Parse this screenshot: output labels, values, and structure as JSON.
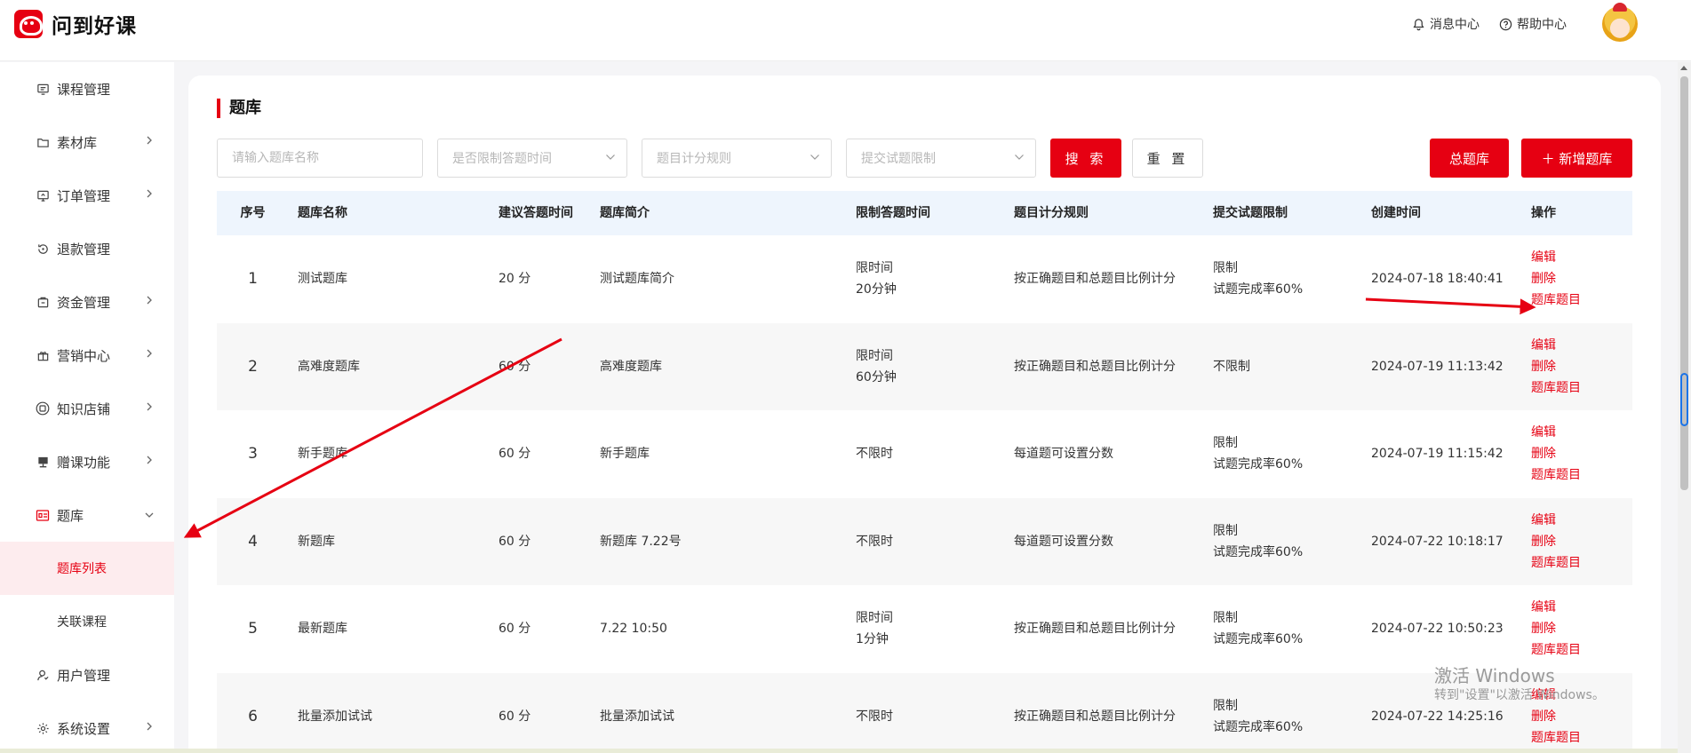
{
  "app": {
    "name": "问到好课"
  },
  "header": {
    "messages": "消息中心",
    "help": "帮助中心"
  },
  "sidebar": {
    "items": [
      {
        "label": "课程管理",
        "icon": "course-icon"
      },
      {
        "label": "素材库",
        "icon": "folder-icon"
      },
      {
        "label": "订单管理",
        "icon": "order-icon"
      },
      {
        "label": "退款管理",
        "icon": "refund-icon"
      },
      {
        "label": "资金管理",
        "icon": "wallet-icon"
      },
      {
        "label": "营销中心",
        "icon": "gift-icon"
      },
      {
        "label": "知识店铺",
        "icon": "shop-icon"
      },
      {
        "label": "赠课功能",
        "icon": "gift-course-icon"
      },
      {
        "label": "题库",
        "icon": "quiz-icon"
      },
      {
        "label": "用户管理",
        "icon": "user-icon"
      },
      {
        "label": "系统设置",
        "icon": "gear-icon"
      }
    ],
    "sub": [
      {
        "label": "题库列表",
        "active": true
      },
      {
        "label": "关联课程",
        "active": false
      }
    ]
  },
  "page": {
    "title": "题库"
  },
  "filters": {
    "name_placeholder": "请输入题库名称",
    "time_limit": "是否限制答题时间",
    "scoring": "题目计分规则",
    "submit_limit": "提交试题限制",
    "search": "搜 索",
    "reset": "重 置",
    "all_banks": "总题库",
    "add_bank": "＋ 新增题库"
  },
  "table": {
    "headers": [
      "序号",
      "题库名称",
      "建议答题时间",
      "题库简介",
      "限制答题时间",
      "题目计分规则",
      "提交试题限制",
      "创建时间",
      "操作"
    ],
    "actions": [
      "编辑",
      "删除",
      "题库题目"
    ],
    "rows": [
      {
        "no": "1",
        "name": "测试题库",
        "suggest": "20 分",
        "intro": "测试题库简介",
        "limit1": "限时间",
        "limit2": "20分钟",
        "rule": "按正确题目和总题目比例计分",
        "submit1": "限制",
        "submit2": "试题完成率60%",
        "created": "2024-07-18 18:40:41"
      },
      {
        "no": "2",
        "name": "高难度题库",
        "suggest": "60 分",
        "intro": "高难度题库",
        "limit1": "限时间",
        "limit2": "60分钟",
        "rule": "按正确题目和总题目比例计分",
        "submit1": "不限制",
        "submit2": "",
        "created": "2024-07-19 11:13:42"
      },
      {
        "no": "3",
        "name": "新手题库",
        "suggest": "60 分",
        "intro": "新手题库",
        "limit1": "不限时",
        "limit2": "",
        "rule": "每道题可设置分数",
        "submit1": "限制",
        "submit2": "试题完成率60%",
        "created": "2024-07-19 11:15:42"
      },
      {
        "no": "4",
        "name": "新题库",
        "suggest": "60 分",
        "intro": "新题库 7.22号",
        "limit1": "不限时",
        "limit2": "",
        "rule": "每道题可设置分数",
        "submit1": "限制",
        "submit2": "试题完成率60%",
        "created": "2024-07-22 10:18:17"
      },
      {
        "no": "5",
        "name": "最新题库",
        "suggest": "60 分",
        "intro": "7.22 10:50",
        "limit1": "限时间",
        "limit2": "1分钟",
        "rule": "按正确题目和总题目比例计分",
        "submit1": "限制",
        "submit2": "试题完成率60%",
        "created": "2024-07-22 10:50:23"
      },
      {
        "no": "6",
        "name": "批量添加试试",
        "suggest": "60 分",
        "intro": "批量添加试试",
        "limit1": "不限时",
        "limit2": "",
        "rule": "按正确题目和总题目比例计分",
        "submit1": "限制",
        "submit2": "试题完成率60%",
        "created": "2024-07-22 14:25:16"
      }
    ]
  },
  "watermark": {
    "line1": "激活 Windows",
    "line2": "转到\"设置\"以激活 Windows。"
  },
  "colors": {
    "accent": "#e60012",
    "header_row": "#eef5fd",
    "annotation_arrow": "#e60012"
  }
}
